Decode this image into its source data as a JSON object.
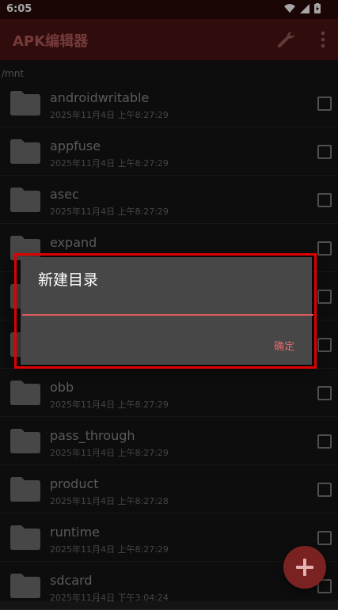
{
  "status": {
    "time": "6:05"
  },
  "app": {
    "title": "APK编辑器"
  },
  "path": "/mnt",
  "files": [
    {
      "name": "androidwritable",
      "date": "2025年11月4日 上午8:27:29"
    },
    {
      "name": "appfuse",
      "date": "2025年11月4日 上午8:27:29"
    },
    {
      "name": "asec",
      "date": "2025年11月4日 上午8:27:29"
    },
    {
      "name": "expand",
      "date": ""
    },
    {
      "name": "",
      "date": ""
    },
    {
      "name": "",
      "date": ""
    },
    {
      "name": "obb",
      "date": "2025年11月4日 上午8:27:29"
    },
    {
      "name": "pass_through",
      "date": "2025年11月4日 上午8:27:29"
    },
    {
      "name": "product",
      "date": "2025年11月4日 上午8:27:28"
    },
    {
      "name": "runtime",
      "date": "2025年11月4日 上午8:27:29"
    },
    {
      "name": "sdcard",
      "date": "2025年11月4日 下午3:04:24"
    }
  ],
  "dialog": {
    "title": "新建目录",
    "input_value": "",
    "confirm_label": "确定"
  },
  "colors": {
    "accent": "#e05a5a",
    "appbar": "#4a1313",
    "fab": "#7a2222",
    "highlight": "#e00000"
  },
  "icons": {
    "wrench": "wrench-icon",
    "more": "more-vert-icon",
    "folder": "folder-icon",
    "add": "add-icon"
  }
}
